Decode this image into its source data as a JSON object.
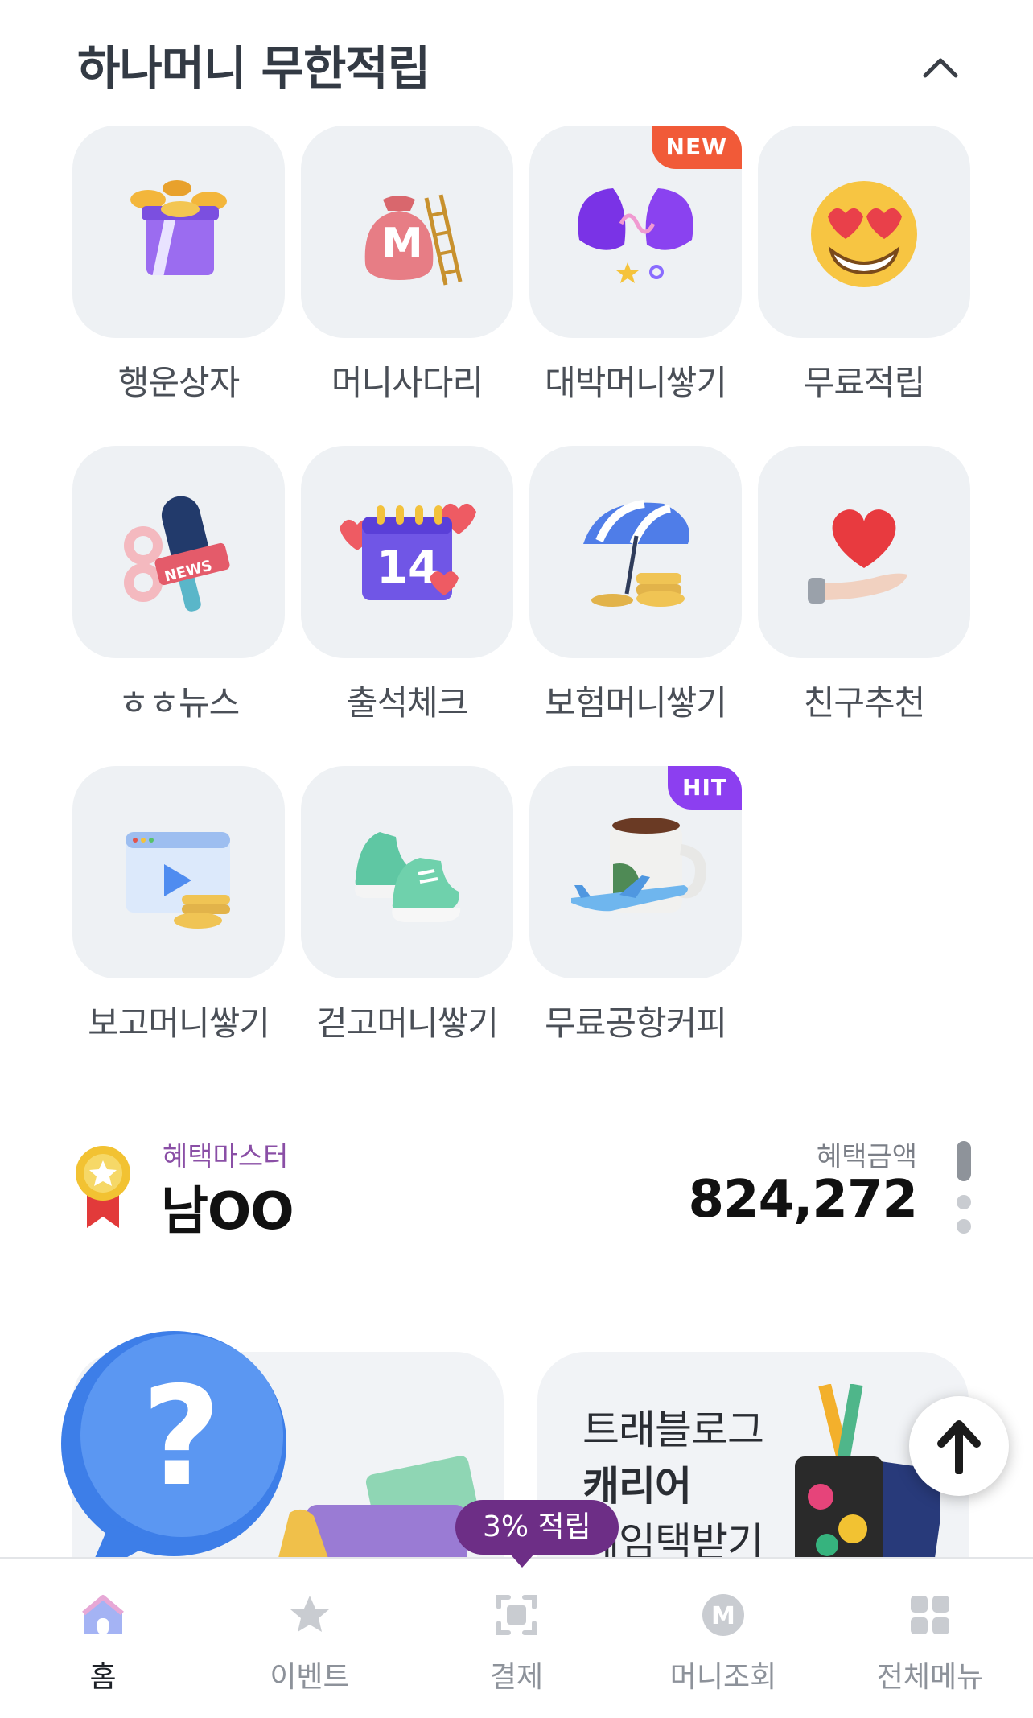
{
  "header": {
    "title": "하나머니 무한적립"
  },
  "tiles": [
    {
      "label": "행운상자",
      "icon": "gift-box-icon",
      "badge": ""
    },
    {
      "label": "머니사다리",
      "icon": "money-bag-ladder-icon",
      "badge": ""
    },
    {
      "label": "대박머니쌓기",
      "icon": "purple-egg-icon",
      "badge": "NEW"
    },
    {
      "label": "무료적립",
      "icon": "heart-eyes-emoji-icon",
      "badge": ""
    },
    {
      "label": "ㅎㅎ뉴스",
      "icon": "news-microphone-icon",
      "badge": ""
    },
    {
      "label": "출석체크",
      "icon": "calendar-14-icon",
      "badge": ""
    },
    {
      "label": "보험머니쌓기",
      "icon": "umbrella-coins-icon",
      "badge": ""
    },
    {
      "label": "친구추천",
      "icon": "heart-hand-icon",
      "badge": ""
    },
    {
      "label": "보고머니쌓기",
      "icon": "video-coins-icon",
      "badge": ""
    },
    {
      "label": "걷고머니쌓기",
      "icon": "sneakers-icon",
      "badge": ""
    },
    {
      "label": "무료공항커피",
      "icon": "coffee-airplane-icon",
      "badge": "HIT"
    }
  ],
  "master": {
    "caption": "혜택마스터",
    "name": "남OO",
    "amount_caption": "혜택금액",
    "amount": "824,272"
  },
  "banners": {
    "right_line1": "트래블로그",
    "right_line2": "캐리어",
    "right_line3": "페임택받기"
  },
  "tooltip": "3% 적립",
  "tabs": [
    {
      "label": "홈",
      "icon": "home-icon",
      "active": true
    },
    {
      "label": "이벤트",
      "icon": "star-icon",
      "active": false
    },
    {
      "label": "결제",
      "icon": "scan-icon",
      "active": false
    },
    {
      "label": "머니조회",
      "icon": "money-m-icon",
      "active": false
    },
    {
      "label": "전체메뉴",
      "icon": "grid-menu-icon",
      "active": false
    }
  ],
  "colors": {
    "new_badge": "#f15a38",
    "hit_badge": "#8c3ff0",
    "tooltip": "#6d2e86",
    "tile_bg": "#eef1f4"
  }
}
